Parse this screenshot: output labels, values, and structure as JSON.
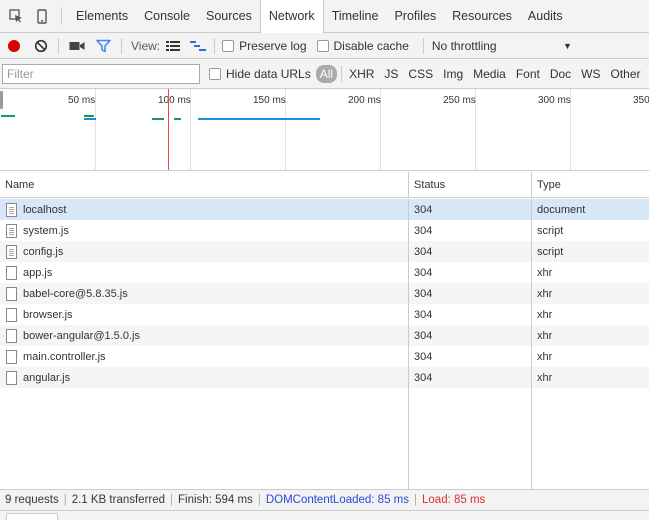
{
  "tabs": [
    {
      "label": "Elements"
    },
    {
      "label": "Console"
    },
    {
      "label": "Sources"
    },
    {
      "label": "Network",
      "active": true
    },
    {
      "label": "Timeline"
    },
    {
      "label": "Profiles"
    },
    {
      "label": "Resources"
    },
    {
      "label": "Audits"
    }
  ],
  "toolbar": {
    "view_label": "View:",
    "preserve_log_label": "Preserve log",
    "disable_cache_label": "Disable cache",
    "throttling_value": "No throttling",
    "colors": {
      "record": "#d90000",
      "filter_active": "#4285f4"
    }
  },
  "filterbar": {
    "placeholder": "Filter",
    "hide_data_urls_label": "Hide data URLs",
    "types": [
      "All",
      "XHR",
      "JS",
      "CSS",
      "Img",
      "Media",
      "Font",
      "Doc",
      "WS",
      "Other"
    ]
  },
  "overview": {
    "ticks": [
      "50 ms",
      "100 ms",
      "150 ms",
      "200 ms",
      "250 ms",
      "300 ms",
      "350"
    ],
    "colors": {
      "waiting": "#0f9d58",
      "download": "#1a8fd8",
      "load_line": "#e34b4b"
    }
  },
  "table": {
    "headers": {
      "name": "Name",
      "status": "Status",
      "type": "Type"
    },
    "rows": [
      {
        "name": "localhost",
        "status": "304",
        "type": "document"
      },
      {
        "name": "system.js",
        "status": "304",
        "type": "script"
      },
      {
        "name": "config.js",
        "status": "304",
        "type": "script"
      },
      {
        "name": "app.js",
        "status": "304",
        "type": "xhr"
      },
      {
        "name": "babel-core@5.8.35.js",
        "status": "304",
        "type": "xhr"
      },
      {
        "name": "browser.js",
        "status": "304",
        "type": "xhr"
      },
      {
        "name": "bower-angular@1.5.0.js",
        "status": "304",
        "type": "xhr"
      },
      {
        "name": "main.controller.js",
        "status": "304",
        "type": "xhr"
      },
      {
        "name": "angular.js",
        "status": "304",
        "type": "xhr"
      }
    ]
  },
  "statusbar": {
    "requests": "9 requests",
    "transferred": "2.1 KB transferred",
    "finish": "Finish: 594 ms",
    "dom_content_loaded": "DOMContentLoaded: 85 ms",
    "load": "Load: 85 ms",
    "colors": {
      "dom": "#2a4bd7",
      "load": "#d93030"
    }
  }
}
